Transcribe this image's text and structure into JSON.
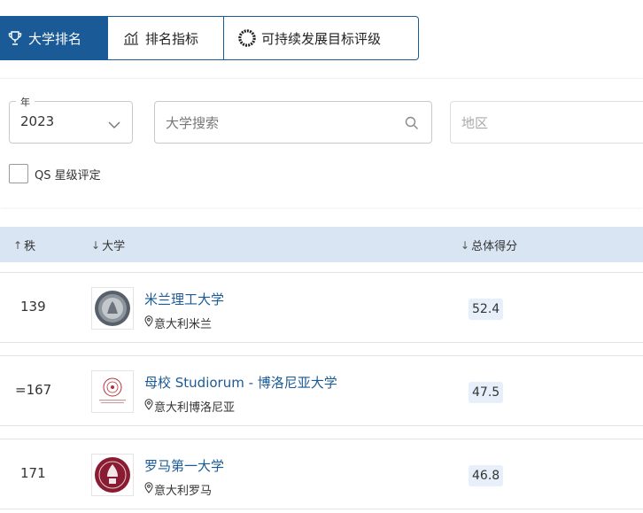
{
  "tabs": [
    {
      "label": "大学排名",
      "icon": "trophy-icon",
      "active": true
    },
    {
      "label": "排名指标",
      "icon": "bar-chart-icon",
      "active": false
    },
    {
      "label": "可持续发展目标评级",
      "icon": "sdg-wheel-icon",
      "active": false
    }
  ],
  "filters": {
    "year_label": "年",
    "year_value": "2023",
    "search_placeholder": "大学搜索",
    "region_placeholder": "地区",
    "qs_stars_label": "QS 星级评定"
  },
  "table": {
    "headers": {
      "rank": "秩",
      "university": "大学",
      "overall_score": "总体得分"
    },
    "rows": [
      {
        "rank": "139",
        "name": "米兰理工大学",
        "location": "意大利米兰",
        "score": "52.4"
      },
      {
        "rank": "=167",
        "name": "母校 Studiorum - 博洛尼亚大学",
        "location": "意大利博洛尼亚",
        "score": "47.5"
      },
      {
        "rank": "171",
        "name": "罗马第一大学",
        "location": "意大利罗马",
        "score": "46.8"
      }
    ]
  },
  "colors": {
    "brand": "#1a5a96",
    "header_bg": "#d9e5f3",
    "score_bg": "#e7f0fa"
  }
}
